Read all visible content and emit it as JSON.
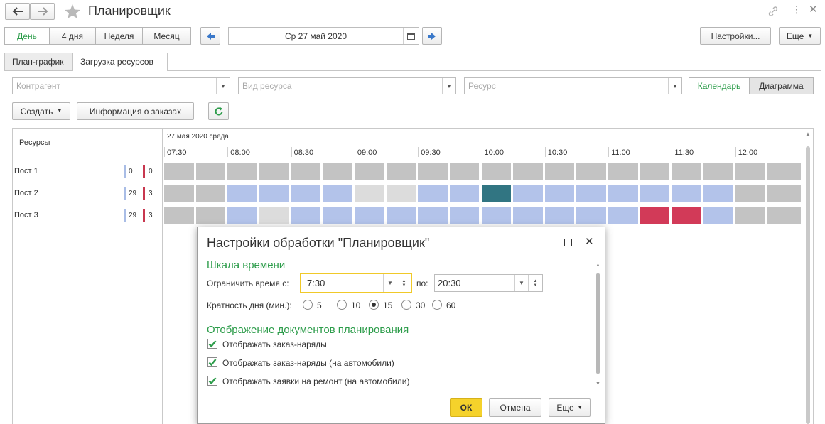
{
  "window": {
    "title": "Планировщик"
  },
  "toolbar": {
    "periods": [
      "День",
      "4 дня",
      "Неделя",
      "Месяц"
    ],
    "date": "Ср 27 май 2020",
    "settings_label": "Настройки...",
    "more_label": "Еще"
  },
  "tabs": [
    "План-график",
    "Загрузка ресурсов"
  ],
  "filters": {
    "counterparty_placeholder": "Контрагент",
    "resource_type_placeholder": "Вид ресурса",
    "resource_placeholder": "Ресурс",
    "view_modes": [
      "Календарь",
      "Диаграмма"
    ]
  },
  "actions": {
    "create_label": "Создать",
    "orders_info_label": "Информация о заказах"
  },
  "gantt": {
    "resources_header": "Ресурсы",
    "date_header": "27 мая 2020 среда",
    "times": [
      "07:30",
      "08:00",
      "08:30",
      "09:00",
      "09:30",
      "10:00",
      "10:30",
      "11:00",
      "11:30",
      "12:00"
    ],
    "rows": [
      {
        "name": "Пост 1",
        "count_a": "0",
        "count_b": "0",
        "cells": [
          "g",
          "g",
          "g",
          "g",
          "g",
          "g",
          "g",
          "g",
          "g",
          "g",
          "g",
          "g",
          "g",
          "g",
          "g",
          "g",
          "g",
          "g",
          "g",
          "g"
        ]
      },
      {
        "name": "Пост 2",
        "count_a": "29",
        "count_b": "3",
        "cells": [
          "g",
          "g",
          "b",
          "b",
          "b",
          "b",
          "l",
          "l",
          "b",
          "b",
          "t",
          "b",
          "b",
          "b",
          "b",
          "b",
          "b",
          "b",
          "g",
          "g"
        ]
      },
      {
        "name": "Пост 3",
        "count_a": "29",
        "count_b": "3",
        "cells": [
          "g",
          "g",
          "b",
          "l",
          "b",
          "b",
          "b",
          "b",
          "b",
          "b",
          "b",
          "b",
          "b",
          "b",
          "b",
          "r",
          "r",
          "b",
          "g",
          "g"
        ]
      }
    ],
    "colors": {
      "g": "#c3c3c3",
      "b": "#b3c3ea",
      "l": "#dcdcdc",
      "t": "#317582",
      "r": "#d23a58"
    }
  },
  "dialog": {
    "title": "Настройки обработки \"Планировщик\"",
    "section_timescale": "Шкала времени",
    "limit_label": "Ограничить время с:",
    "time_from": "7:30",
    "to_label": "по:",
    "time_to": "20:30",
    "step_label": "Кратность дня (мин.):",
    "step_options": [
      "5",
      "10",
      "15",
      "30",
      "60"
    ],
    "step_selected": "15",
    "section_display": "Отображение документов планирования",
    "checkboxes": [
      {
        "label": "Отображать заказ-наряды",
        "checked": true
      },
      {
        "label": "Отображать заказ-наряды (на автомобили)",
        "checked": true
      },
      {
        "label": "Отображать заявки на ремонт (на автомобили)",
        "checked": true
      }
    ],
    "ok_label": "ОК",
    "cancel_label": "Отмена",
    "more_label": "Еще"
  }
}
